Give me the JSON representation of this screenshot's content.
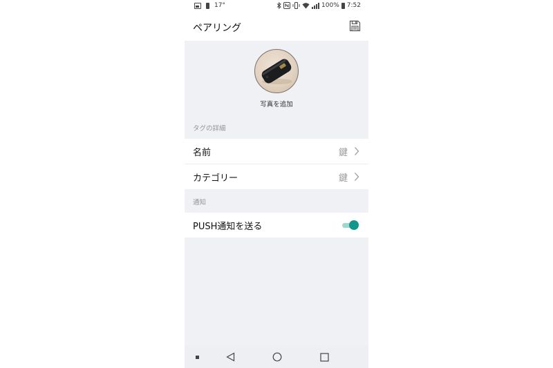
{
  "status_bar": {
    "temperature": "17°",
    "battery_percent": "100%",
    "time": "7:52",
    "icons": [
      "image-icon",
      "battery-icon",
      "bluetooth-icon",
      "nfc-icon",
      "vibrate-icon",
      "wifi-icon",
      "signal-icon"
    ]
  },
  "header": {
    "title": "ペアリング",
    "save_icon": "save-icon"
  },
  "photo": {
    "add_label": "写真を追加"
  },
  "tag_details": {
    "section_label": "タグの詳細",
    "rows": [
      {
        "label": "名前",
        "value": "鍵"
      },
      {
        "label": "カテゴリー",
        "value": "鍵"
      }
    ]
  },
  "notification": {
    "section_label": "通知",
    "push_label": "PUSH通知を送る",
    "push_enabled": true
  },
  "nav_bar": {
    "icons": [
      "square-dot-icon",
      "back-icon",
      "home-icon",
      "recents-icon"
    ]
  },
  "colors": {
    "accent": "#13968a",
    "accent_track": "#9fd8cf",
    "background": "#f0f1f4"
  }
}
